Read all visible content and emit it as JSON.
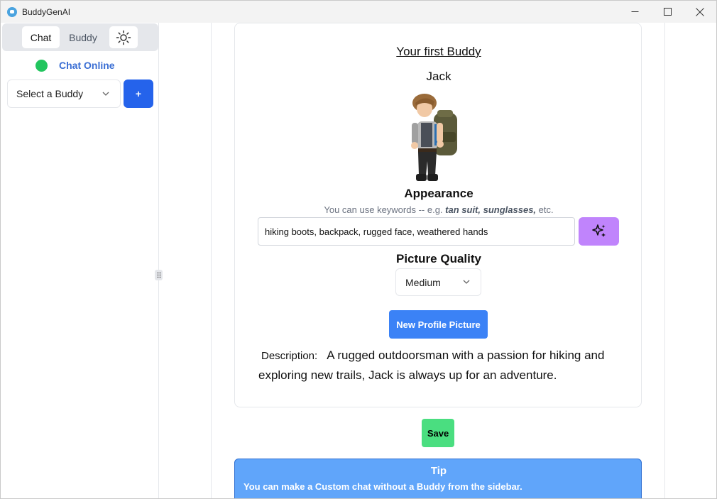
{
  "window": {
    "title": "BuddyGenAI",
    "minimize": "—",
    "maximize": "☐",
    "close": "✕"
  },
  "sidebar": {
    "tabs": [
      {
        "label": "Chat"
      },
      {
        "label": "Buddy"
      }
    ],
    "theme_toggle_icon": "sun-icon",
    "status": {
      "label": "Chat Online",
      "color": "#22c55e"
    },
    "buddy_select": {
      "value": "Select a Buddy"
    },
    "add_button": {
      "label": "+"
    }
  },
  "main": {
    "first_buddy_heading": "Your first Buddy",
    "buddy_name": "Jack",
    "appearance": {
      "heading": "Appearance",
      "hint_prefix": "You can use keywords -- e.g. ",
      "hint_keywords": "tan suit, sunglasses,",
      "hint_suffix": " etc.",
      "value": "hiking boots, backpack, rugged face, weathered hands",
      "generate_icon": "sparkles-icon"
    },
    "quality": {
      "heading": "Picture Quality",
      "value": "Medium"
    },
    "new_picture_button": "New Profile Picture",
    "description": {
      "label": "Description:",
      "text": "A rugged outdoorsman with a passion for hiking and exploring new trails, Jack is always up for an adventure."
    },
    "save_button": "Save",
    "tip": {
      "title": "Tip",
      "text": "You can make a Custom chat without a Buddy from the sidebar."
    }
  },
  "colors": {
    "primary_blue": "#2563eb",
    "button_blue": "#3b82f6",
    "save_green": "#4ade80",
    "magic_purple": "#c084fc",
    "tip_blue": "#60a5fa"
  }
}
